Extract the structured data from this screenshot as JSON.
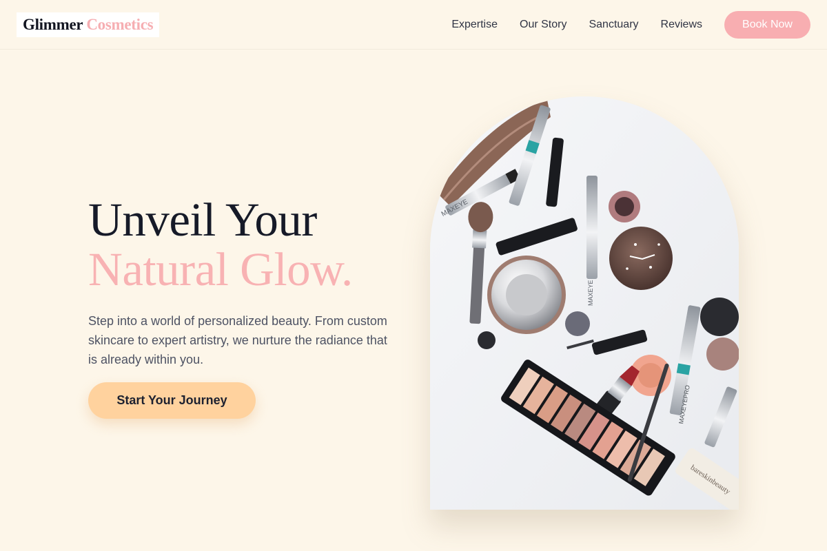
{
  "header": {
    "logo": {
      "part1": "Glimmer",
      "part2": "Cosmetics"
    },
    "nav": [
      {
        "label": "Expertise"
      },
      {
        "label": "Our Story"
      },
      {
        "label": "Sanctuary"
      },
      {
        "label": "Reviews"
      }
    ],
    "book_button": "Book Now"
  },
  "hero": {
    "title_line1": "Unveil Your",
    "title_line2": "Natural Glow.",
    "subtitle": "Step into a world of personalized beauty. From custom skincare to expert artistry, we nurture the radiance that is already within you.",
    "cta_label": "Start Your Journey"
  },
  "image": {
    "product_texts": {
      "brand_a": "MAXEYE",
      "brand_b": "MAXEYEPRO",
      "tube_label": "bareskinbeauty"
    }
  },
  "colors": {
    "background": "#fdf6e9",
    "accent_pink": "#f8aeb1",
    "cta_peach": "#ffd29e",
    "heading_dark": "#161a28",
    "body_text": "#4d5263"
  }
}
